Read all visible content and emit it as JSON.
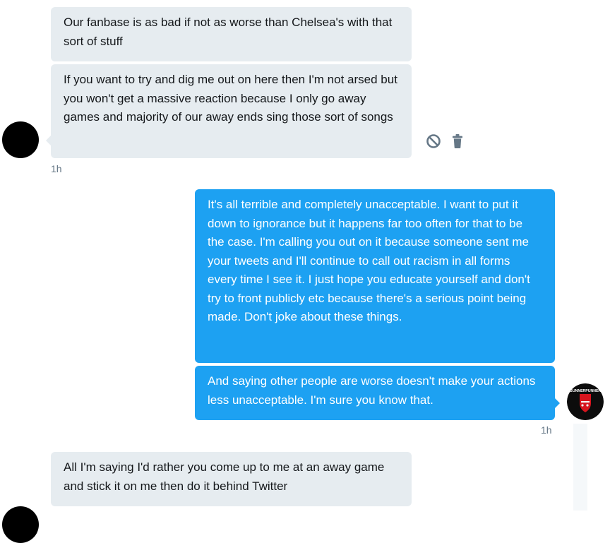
{
  "conversation": {
    "messages": [
      {
        "sender": "other",
        "text": "Our fanbase is as bad if not as worse than Chelsea's with that sort of stuff"
      },
      {
        "sender": "other",
        "text": "If you want to try and dig me out on here then I'm not arsed but you won't get a massive reaction because I only go away games and majority of our away ends sing those sort of songs"
      },
      {
        "sender": "self",
        "text": "It's all terrible and completely unacceptable. I want to put it down to ignorance but it happens far too often for that to be the case. I'm calling you out on it because someone sent me your tweets and I'll continue to call out racism in all forms every time I see it. I just hope you educate yourself and don't try to front publicly etc because there's a serious point being made. Don't joke about these things."
      },
      {
        "sender": "self",
        "text": "And saying other people are worse doesn't make your actions less unacceptable. I'm sure you know that."
      },
      {
        "sender": "other",
        "text": "All I'm saying I'd rather you come up to me at an away game and stick it on me then do it behind Twitter"
      }
    ],
    "timestamps": {
      "group1": "1h",
      "group2": "1h"
    },
    "self_avatar_text": "GUNNERPUNNER",
    "colors": {
      "incoming_bg": "#e6ecf0",
      "outgoing_bg": "#1da1f2",
      "timestamp": "#657786",
      "icon": "#657786"
    },
    "icons": {
      "report": "block-icon",
      "delete": "trash-icon"
    }
  }
}
